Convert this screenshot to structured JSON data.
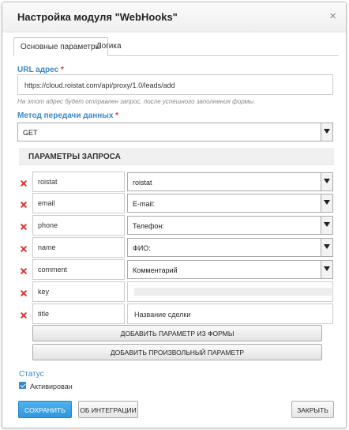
{
  "dialog": {
    "title": "Настройка модуля \"WebHooks\"",
    "close_glyph": "×"
  },
  "tabs": [
    {
      "label": "Основные параметры",
      "active": true
    },
    {
      "label": "Логика",
      "active": false
    }
  ],
  "url": {
    "label": "URL адрес",
    "required_mark": "*",
    "value": "https://cloud.roistat.com/api/proxy/1.0/leads/add",
    "hint": "На этот адрес будет отправлен запрос, после успешного заполнения формы."
  },
  "method": {
    "label": "Метод передачи данных",
    "required_mark": "*",
    "value": "GET"
  },
  "params_section": {
    "title": "ПАРАМЕТРЫ ЗАПРОСА",
    "rows": [
      {
        "name": "roistat",
        "value": "roistat",
        "type": "select"
      },
      {
        "name": "email",
        "value": "E-mail:",
        "type": "select"
      },
      {
        "name": "phone",
        "value": "Телефон:",
        "type": "select"
      },
      {
        "name": "name",
        "value": "ФИО:",
        "type": "select"
      },
      {
        "name": "comment",
        "value": "Комментарий",
        "type": "select"
      },
      {
        "name": "key",
        "value": "",
        "type": "input-masked"
      },
      {
        "name": "title",
        "value": "Название сделки",
        "type": "input"
      }
    ],
    "add_from_form_label": "ДОБАВИТЬ ПАРАМЕТР ИЗ ФОРМЫ",
    "add_custom_label": "ДОБАВИТЬ ПРОИЗВОЛЬНЫЙ ПАРАМЕТР"
  },
  "status": {
    "label": "Статус",
    "checkbox_label": "Активирован",
    "checked": true
  },
  "footer": {
    "save_label": "СОХРАНИТЬ",
    "about_label": "ОБ ИНТЕГРАЦИИ",
    "close_label": "ЗАКРЫТЬ"
  },
  "colors": {
    "accent": "#3a88c8",
    "primary_button": "#2f97dd",
    "remove_icon": "#dd3333"
  }
}
